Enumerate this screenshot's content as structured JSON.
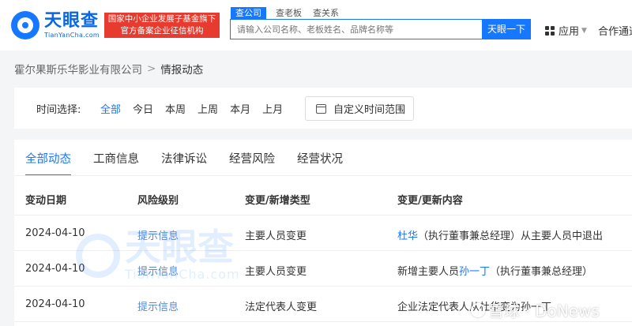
{
  "header": {
    "logo_cn": "天眼查",
    "logo_en": "TianYanCha.com",
    "badge_line1": "国家中小企业发展子基金旗下",
    "badge_line2": "官方备案企业征信机构",
    "search_tabs": [
      "查公司",
      "查老板",
      "查关系"
    ],
    "search_placeholder": "请输入公司名称、老板姓名、品牌名称等",
    "search_button": "天眼一下",
    "apps_label": "应用",
    "coop_label": "合作通道"
  },
  "breadcrumb": {
    "company": "霍尔果斯乐华影业有限公司",
    "separator": ">",
    "current": "情报动态"
  },
  "time_filter": {
    "label": "时间选择:",
    "options": [
      "全部",
      "今日",
      "本周",
      "上周",
      "本月",
      "上月"
    ],
    "active_index": 0,
    "custom_label": "自定义时间范围"
  },
  "tabs": [
    "全部动态",
    "工商信息",
    "法律诉讼",
    "经营风险",
    "经营状况"
  ],
  "table": {
    "headers": [
      "变动日期",
      "风险级别",
      "变更/新增类型",
      "变更/更新内容"
    ],
    "rows": [
      {
        "date": "2024-04-10",
        "level": "提示信息",
        "type": "主要人员变更",
        "pre": "",
        "link": "杜华",
        "post": "（执行董事兼总经理）从主要人员中退出"
      },
      {
        "date": "2024-04-10",
        "level": "提示信息",
        "type": "主要人员变更",
        "pre": "新增主要人员",
        "link": "孙一丁",
        "post": "（执行董事兼总经理）"
      },
      {
        "date": "2024-04-10",
        "level": "提示信息",
        "type": "法定代表人变更",
        "pre": "企业法定代表人从杜华变为孙一丁",
        "link": "",
        "post": ""
      }
    ]
  },
  "watermark": {
    "cn": "天眼查",
    "en": "TianYanCha.com",
    "source": "雪球 · DoNews"
  },
  "colors": {
    "accent": "#1677ff",
    "badge": "#e63b2e",
    "risk": "#5b8bd9"
  }
}
